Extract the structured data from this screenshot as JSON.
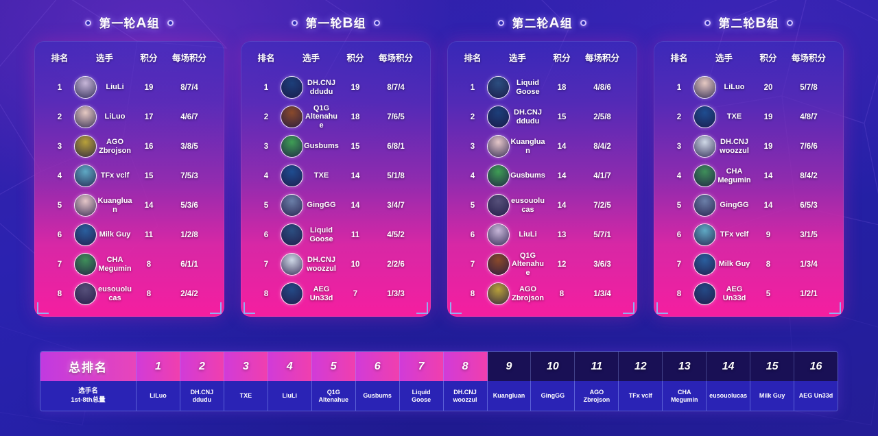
{
  "groups": [
    {
      "title_prefix": "第一轮",
      "title_big": "A",
      "title_suffix": "组",
      "columns": {
        "rank": "排名",
        "player": "选手",
        "points": "积分",
        "per_match": "每场积分"
      },
      "rows": [
        {
          "rank": "1",
          "name": "LiuLi",
          "points": "19",
          "per_match": "8/7/4",
          "avatar": "#c7b6d8"
        },
        {
          "rank": "2",
          "name": "LiLuo",
          "points": "17",
          "per_match": "4/6/7",
          "avatar": "#e6c9c2"
        },
        {
          "rank": "3",
          "name": "AGO Zbrojson",
          "points": "16",
          "per_match": "3/8/5",
          "avatar": "#b8a13a"
        },
        {
          "rank": "4",
          "name": "TFx vclf",
          "points": "15",
          "per_match": "7/5/3",
          "avatar": "#5fa9c4"
        },
        {
          "rank": "5",
          "name": "Kuangluan",
          "points": "14",
          "per_match": "5/3/6",
          "avatar": "#e5c6c8"
        },
        {
          "rank": "6",
          "name": "Milk Guy",
          "points": "11",
          "per_match": "1/2/8",
          "avatar": "#2a5f9e"
        },
        {
          "rank": "7",
          "name": "CHA Megumin",
          "points": "8",
          "per_match": "6/1/1",
          "avatar": "#3f8f5a"
        },
        {
          "rank": "8",
          "name": "eusouolucas",
          "points": "8",
          "per_match": "2/4/2",
          "avatar": "#56507a"
        }
      ]
    },
    {
      "title_prefix": "第一轮",
      "title_big": "B",
      "title_suffix": "组",
      "columns": {
        "rank": "排名",
        "player": "选手",
        "points": "积分",
        "per_match": "每场积分"
      },
      "rows": [
        {
          "rank": "1",
          "name": "DH.CNJ ddudu",
          "points": "19",
          "per_match": "8/7/4",
          "avatar": "#1d3f7a"
        },
        {
          "rank": "2",
          "name": "Q1G Altenahue",
          "points": "18",
          "per_match": "7/6/5",
          "avatar": "#8a4a2c"
        },
        {
          "rank": "3",
          "name": "Gusbums",
          "points": "15",
          "per_match": "6/8/1",
          "avatar": "#3f9e55"
        },
        {
          "rank": "4",
          "name": "TXE",
          "points": "14",
          "per_match": "5/1/8",
          "avatar": "#1f4d90"
        },
        {
          "rank": "5",
          "name": "GingGG",
          "points": "14",
          "per_match": "3/4/7",
          "avatar": "#6b7fa8"
        },
        {
          "rank": "6",
          "name": "Liquid Goose",
          "points": "11",
          "per_match": "4/5/2",
          "avatar": "#2c4e80"
        },
        {
          "rank": "7",
          "name": "DH.CNJ woozzul",
          "points": "10",
          "per_match": "2/2/6",
          "avatar": "#cfd8e6"
        },
        {
          "rank": "8",
          "name": "AEG Un33d",
          "points": "7",
          "per_match": "1/3/3",
          "avatar": "#244a86"
        }
      ]
    },
    {
      "title_prefix": "第二轮",
      "title_big": "A",
      "title_suffix": "组",
      "columns": {
        "rank": "排名",
        "player": "选手",
        "points": "积分",
        "per_match": "每场积分"
      },
      "rows": [
        {
          "rank": "1",
          "name": "Liquid Goose",
          "points": "18",
          "per_match": "4/8/6",
          "avatar": "#2c4e80"
        },
        {
          "rank": "2",
          "name": "DH.CNJ ddudu",
          "points": "15",
          "per_match": "2/5/8",
          "avatar": "#1d3f7a"
        },
        {
          "rank": "3",
          "name": "Kuangluan",
          "points": "14",
          "per_match": "8/4/2",
          "avatar": "#e5c6c8"
        },
        {
          "rank": "4",
          "name": "Gusbums",
          "points": "14",
          "per_match": "4/1/7",
          "avatar": "#3f9e55"
        },
        {
          "rank": "5",
          "name": "eusouolucas",
          "points": "14",
          "per_match": "7/2/5",
          "avatar": "#56507a"
        },
        {
          "rank": "6",
          "name": "LiuLi",
          "points": "13",
          "per_match": "5/7/1",
          "avatar": "#c7b6d8"
        },
        {
          "rank": "7",
          "name": "Q1G Altenahue",
          "points": "12",
          "per_match": "3/6/3",
          "avatar": "#8a4a2c"
        },
        {
          "rank": "8",
          "name": "AGO Zbrojson",
          "points": "8",
          "per_match": "1/3/4",
          "avatar": "#b8a13a"
        }
      ]
    },
    {
      "title_prefix": "第二轮",
      "title_big": "B",
      "title_suffix": "组",
      "columns": {
        "rank": "排名",
        "player": "选手",
        "points": "积分",
        "per_match": "每场积分"
      },
      "rows": [
        {
          "rank": "1",
          "name": "LiLuo",
          "points": "20",
          "per_match": "5/7/8",
          "avatar": "#e6c9c2"
        },
        {
          "rank": "2",
          "name": "TXE",
          "points": "19",
          "per_match": "4/8/7",
          "avatar": "#1f4d90"
        },
        {
          "rank": "3",
          "name": "DH.CNJ woozzul",
          "points": "19",
          "per_match": "7/6/6",
          "avatar": "#cfd8e6"
        },
        {
          "rank": "4",
          "name": "CHA Megumin",
          "points": "14",
          "per_match": "8/4/2",
          "avatar": "#3f8f5a"
        },
        {
          "rank": "5",
          "name": "GingGG",
          "points": "14",
          "per_match": "6/5/3",
          "avatar": "#6b7fa8"
        },
        {
          "rank": "6",
          "name": "TFx vclf",
          "points": "9",
          "per_match": "3/1/5",
          "avatar": "#5fa9c4"
        },
        {
          "rank": "7",
          "name": "Milk Guy",
          "points": "8",
          "per_match": "1/3/4",
          "avatar": "#2a5f9e"
        },
        {
          "rank": "8",
          "name": "AEG Un33d",
          "points": "5",
          "per_match": "1/2/1",
          "avatar": "#244a86"
        }
      ]
    }
  ],
  "overall": {
    "title": "总排名",
    "row_label_line1": "选手名",
    "row_label_line2": "1st-8th总量",
    "highlight_count": 8,
    "ranks": [
      "1",
      "2",
      "3",
      "4",
      "5",
      "6",
      "7",
      "8",
      "9",
      "10",
      "11",
      "12",
      "13",
      "14",
      "15",
      "16"
    ],
    "names": [
      "LiLuo",
      "DH.CNJ ddudu",
      "TXE",
      "LiuLi",
      "Q1G Altenahue",
      "Gusbums",
      "Liquid Goose",
      "DH.CNJ woozzul",
      "Kuangluan",
      "GingGG",
      "AGO Zbrojson",
      "TFx vclf",
      "CHA Megumin",
      "eusouolucas",
      "Milk Guy",
      "AEG Un33d"
    ]
  },
  "colors": {
    "accent_pink": "#f51ea0",
    "accent_magenta": "#e845ba",
    "bg_blue": "#2b22b0",
    "header_dark": "#191055"
  }
}
